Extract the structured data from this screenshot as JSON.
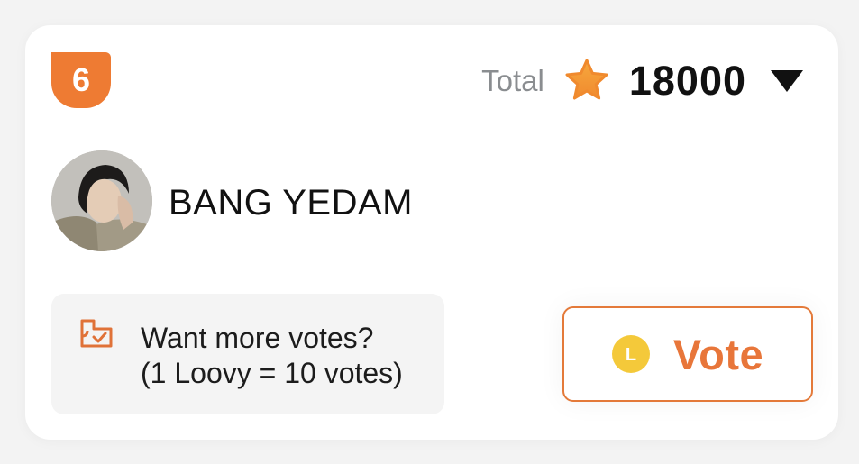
{
  "rank": {
    "value": "6"
  },
  "total": {
    "label": "Total",
    "value": "18000",
    "star_icon": "star-icon",
    "dropdown_icon": "caret-down-icon"
  },
  "artist": {
    "name": "BANG YEDAM",
    "avatar": "avatar"
  },
  "promo": {
    "icon": "ticket-check-icon",
    "line1": "Want more votes?",
    "line2": "(1 Loovy = 10 votes)"
  },
  "vote_button": {
    "label": "Vote",
    "coin_icon": "loovy-coin-icon",
    "coin_letter": "L"
  },
  "colors": {
    "accent": "#ee7b33",
    "vote_text": "#e8763a",
    "coin": "#f4c93a",
    "promo_bg": "#f4f4f4"
  }
}
